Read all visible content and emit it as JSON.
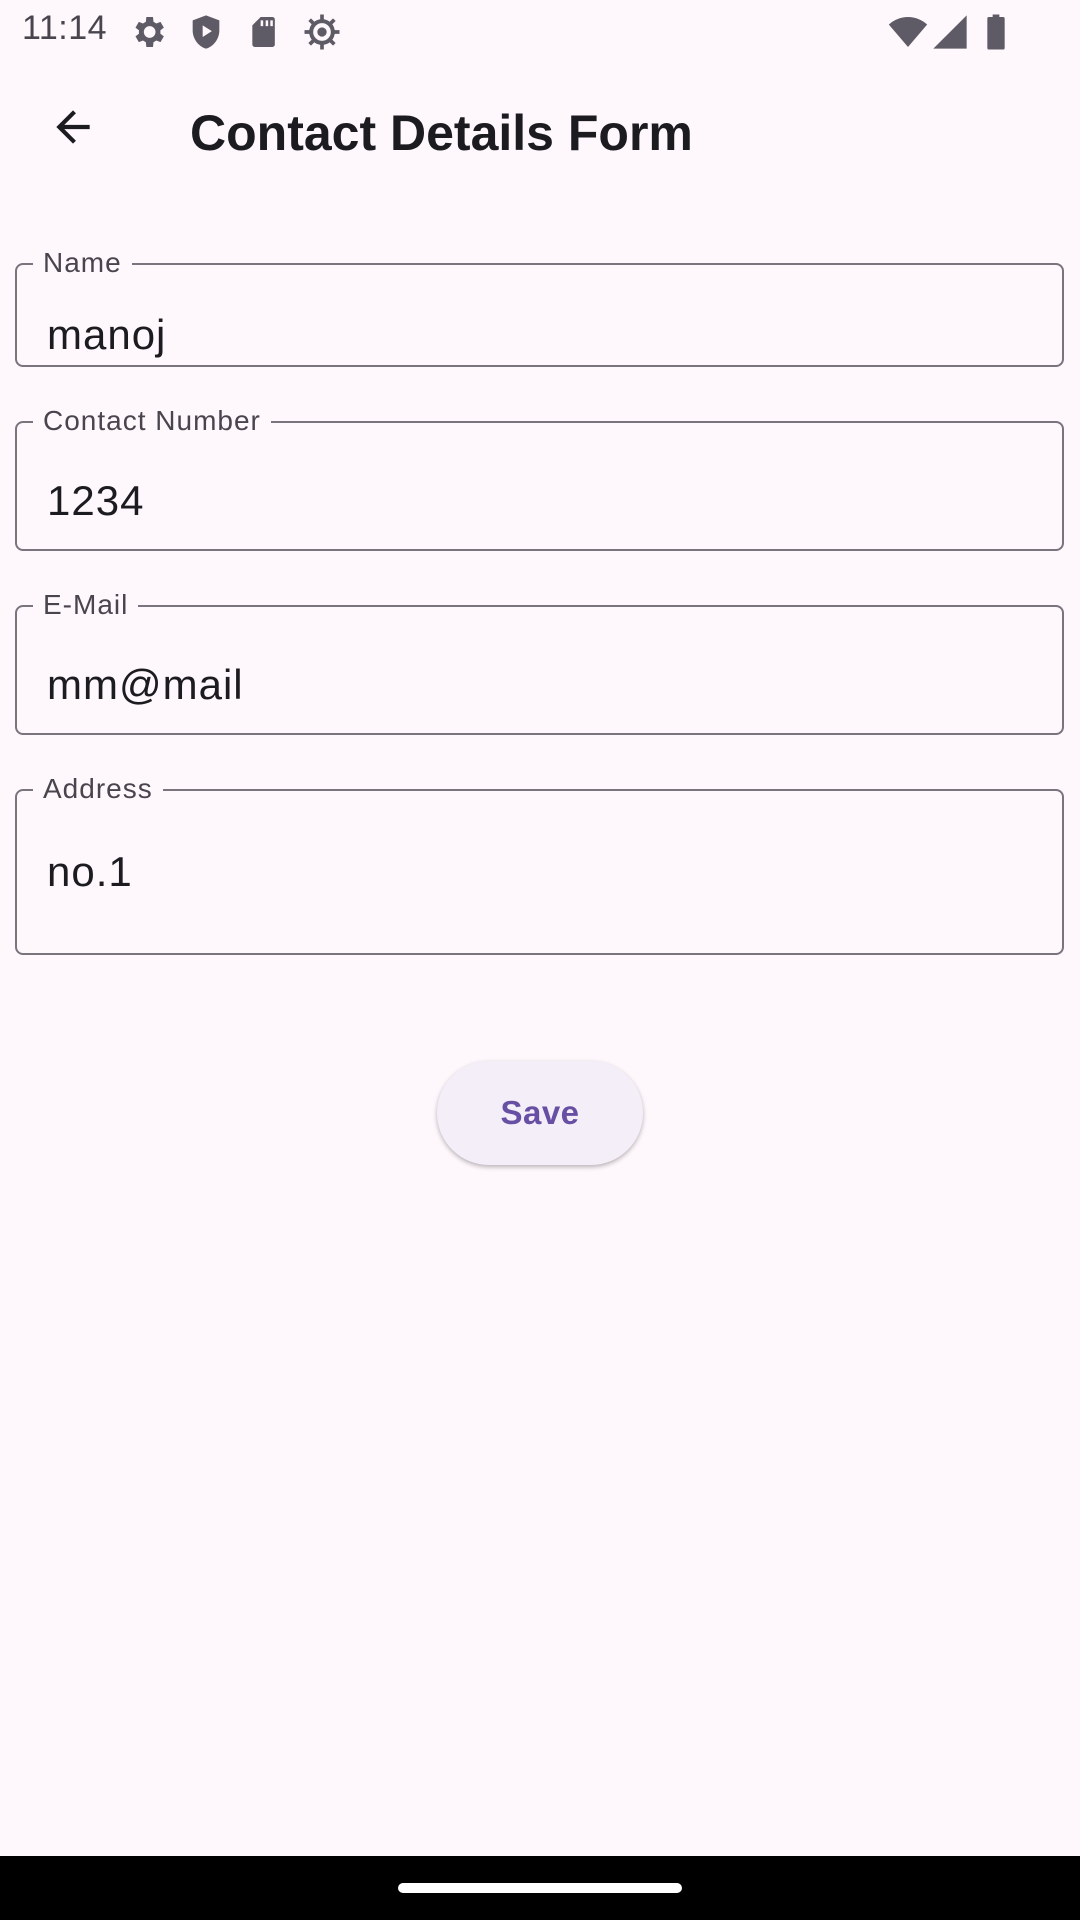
{
  "status_bar": {
    "time": "11:14",
    "left_icons": [
      "settings-gear-icon",
      "shield-play-icon",
      "sd-card-icon",
      "debug-bug-icon"
    ],
    "right_icons": [
      "wifi-icon",
      "cellular-signal-icon",
      "battery-icon"
    ]
  },
  "app_bar": {
    "back_icon": "arrow-back-icon",
    "title": "Contact Details Form"
  },
  "form": {
    "fields": [
      {
        "label": "Name",
        "value": "manoj"
      },
      {
        "label": "Contact Number",
        "value": "1234"
      },
      {
        "label": "E-Mail",
        "value": "mm@mail"
      },
      {
        "label": "Address",
        "value": "no.1"
      }
    ],
    "save_label": "Save"
  },
  "colors": {
    "background": "#FEF7FC",
    "outline": "#79747E",
    "accent": "#6750A4",
    "button_surface": "#F4EEF8",
    "nav_bar": "#000000"
  }
}
